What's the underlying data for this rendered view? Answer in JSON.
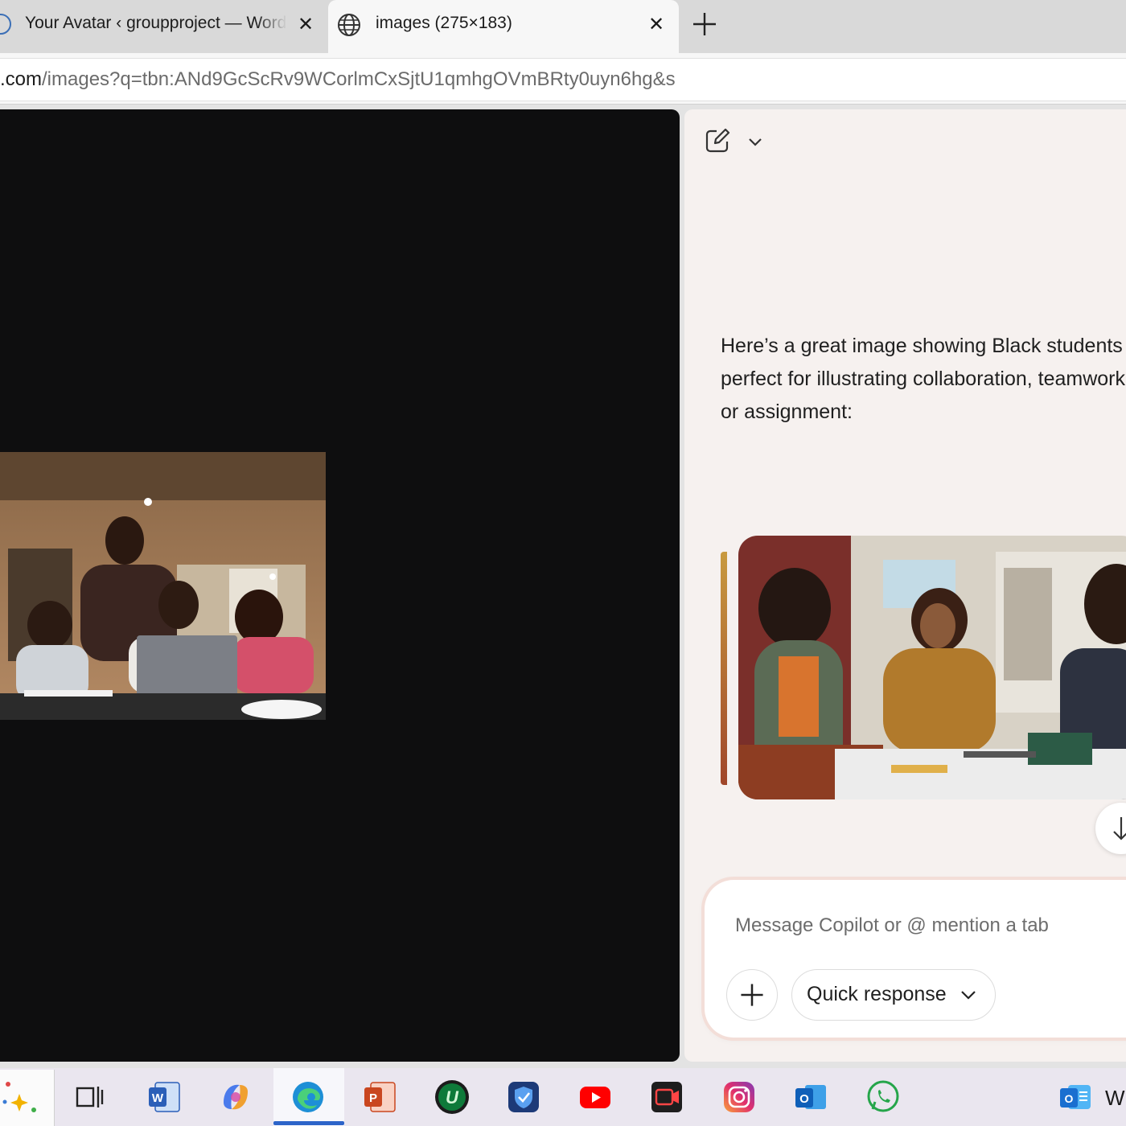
{
  "browser": {
    "tabs": [
      {
        "title": "Your Avatar ‹ groupproject — WordPress",
        "close": "✕",
        "icon": "wordpress-icon"
      },
      {
        "title": "images (275×183)",
        "close": "✕",
        "icon": "globe-icon",
        "active": true
      }
    ],
    "new_tab": "+",
    "address": {
      "host": ".com",
      "path": "/images?q=tbn:ANd9GcScRv9WCorlmCxSjtU1qmhgOVmBRty0uyn6hg&s"
    }
  },
  "copilot": {
    "header_icons": [
      "compose-icon",
      "chevron-down-icon"
    ],
    "message_lines": [
      "Here’s a great image showing Black students",
      "perfect for illustrating collaboration, teamwork,",
      "or assignment:"
    ],
    "input": {
      "placeholder": "Message Copilot or @ mention a tab",
      "quick_response_label": "Quick response"
    }
  },
  "taskbar": {
    "apps": [
      "start-icon",
      "task-view-icon",
      "word-icon",
      "copilot-icon",
      "edge-icon",
      "powerpoint-icon",
      "upwork-icon",
      "vpn-icon",
      "youtube-icon",
      "screen-recorder-icon",
      "instagram-icon",
      "outlook-icon",
      "whatsapp-icon",
      "outlook-new-icon"
    ],
    "active_app": "edge-icon",
    "trailing_text": "W"
  },
  "colors": {
    "viewer_bg": "#0e0e0f",
    "panel_bg": "#f6f1ef",
    "accent": "#2c64c9"
  }
}
